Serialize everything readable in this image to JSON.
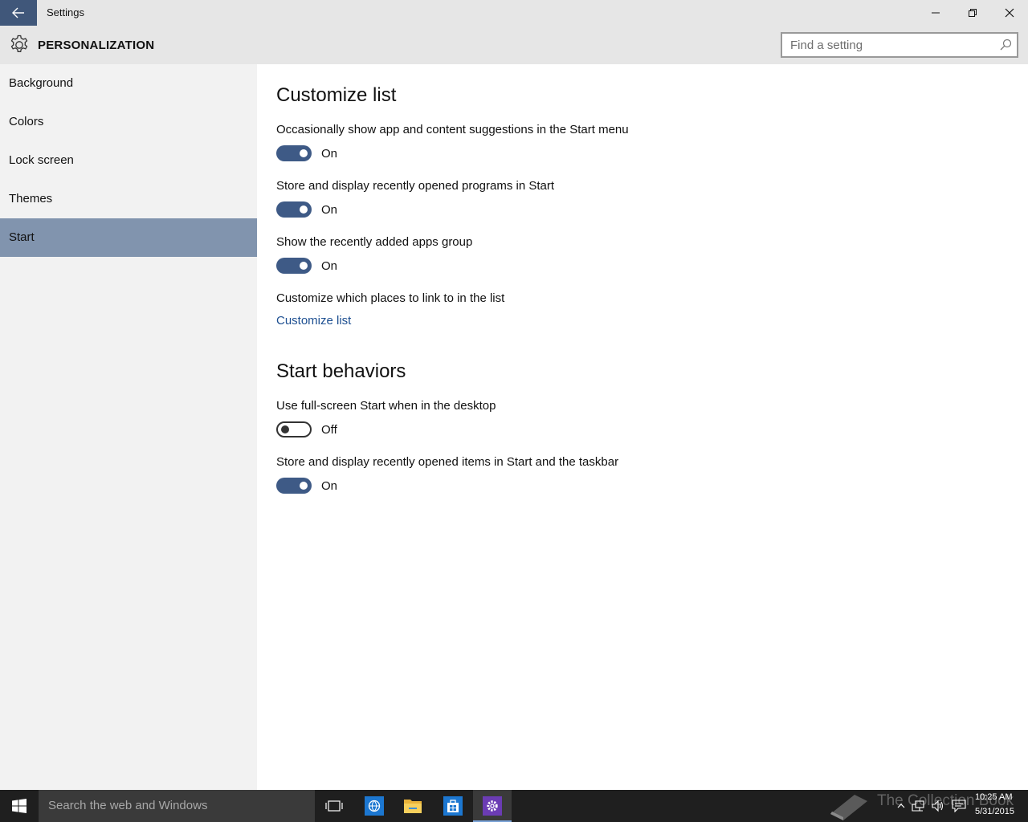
{
  "window": {
    "title": "Settings"
  },
  "header": {
    "page_title": "PERSONALIZATION",
    "search_placeholder": "Find a setting"
  },
  "sidebar": {
    "items": [
      {
        "label": "Background",
        "active": false
      },
      {
        "label": "Colors",
        "active": false
      },
      {
        "label": "Lock screen",
        "active": false
      },
      {
        "label": "Themes",
        "active": false
      },
      {
        "label": "Start",
        "active": true
      }
    ]
  },
  "main": {
    "customize_list": {
      "title": "Customize list",
      "settings": [
        {
          "label": "Occasionally show app and content suggestions in the Start menu",
          "state": "On"
        },
        {
          "label": "Store and display recently opened programs in Start",
          "state": "On"
        },
        {
          "label": "Show the recently added apps group",
          "state": "On"
        }
      ],
      "places_label": "Customize which places to link to in the list",
      "places_link": "Customize list"
    },
    "start_behaviors": {
      "title": "Start behaviors",
      "settings": [
        {
          "label": "Use full-screen Start when in the desktop",
          "state": "Off"
        },
        {
          "label": "Store and display recently opened items in Start and the taskbar",
          "state": "On"
        }
      ]
    }
  },
  "taskbar": {
    "search_text": "Search the web and Windows",
    "watermark": "The Collection Book",
    "clock_time": "10:25 AM",
    "clock_date": "5/31/2015"
  },
  "colors": {
    "accent": "#40577a",
    "sidebar_active": "#8194ae",
    "toggle_on": "#3e5a86",
    "link": "#1d4f91",
    "taskbar": "#1f1f1f"
  },
  "icons": [
    "back-arrow-icon",
    "minimize-icon",
    "restore-icon",
    "close-icon",
    "gear-icon",
    "search-icon",
    "windows-logo-icon",
    "task-view-icon",
    "edge-icon",
    "file-explorer-icon",
    "store-icon",
    "settings-icon",
    "chevron-up-icon",
    "network-icon",
    "volume-icon",
    "action-center-icon",
    "book-icon"
  ]
}
